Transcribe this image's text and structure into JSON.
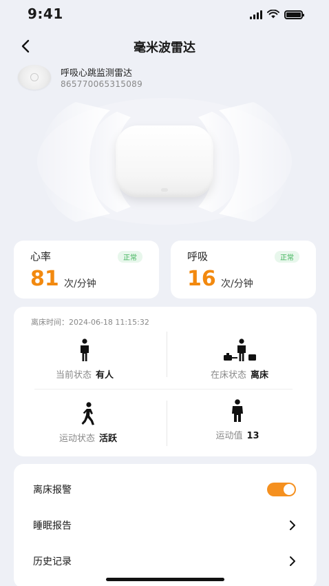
{
  "status_bar": {
    "time": "9:41",
    "icons": [
      "signal-icon",
      "wifi-icon",
      "battery-icon"
    ]
  },
  "nav": {
    "title": "毫米波雷达",
    "back_icon": "chevron-left-icon"
  },
  "device": {
    "name": "呼吸心跳监测雷达",
    "id": "865770065315089"
  },
  "vitals": [
    {
      "label": "心率",
      "badge": "正常",
      "value": "81",
      "unit": "次/分钟"
    },
    {
      "label": "呼吸",
      "badge": "正常",
      "value": "16",
      "unit": "次/分钟"
    }
  ],
  "status": {
    "leave_time": "离床时间：2024-06-18  11:15:32",
    "current_state": {
      "label": "当前状态",
      "value": "有人",
      "icon": "person-standing-icon"
    },
    "bed_state": {
      "label": "在床状态",
      "value": "离床",
      "icon": "person-luggage-icon"
    },
    "motion_state": {
      "label": "运动状态",
      "value": "活跃",
      "icon": "person-walking-icon"
    },
    "motion_value": {
      "label": "运动值",
      "value": "13",
      "icon": "person-icon"
    }
  },
  "settings": [
    {
      "label": "离床报警",
      "type": "toggle",
      "enabled": true
    },
    {
      "label": "睡眠报告",
      "type": "link"
    },
    {
      "label": "历史记录",
      "type": "link"
    }
  ],
  "colors": {
    "accent": "#f5901f",
    "value_orange": "#f2890f",
    "badge_green": "#3fb35a",
    "background": "#eef0f6"
  }
}
